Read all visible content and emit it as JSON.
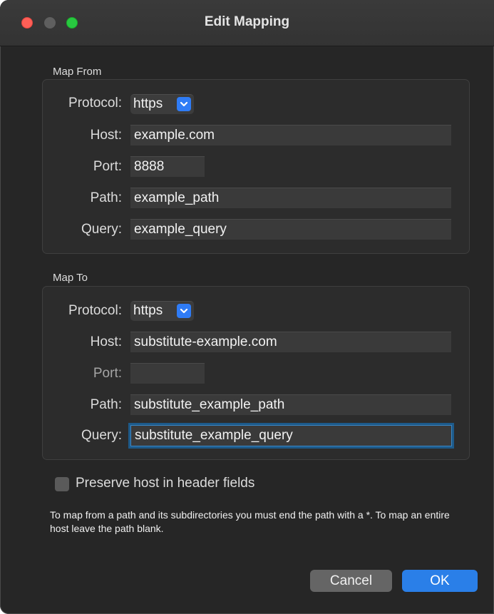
{
  "window": {
    "title": "Edit Mapping"
  },
  "map_from": {
    "section_label": "Map From",
    "protocol_label": "Protocol:",
    "protocol_value": "https",
    "host_label": "Host:",
    "host_value": "example.com",
    "port_label": "Port:",
    "port_value": "8888",
    "path_label": "Path:",
    "path_value": "example_path",
    "query_label": "Query:",
    "query_value": "example_query"
  },
  "map_to": {
    "section_label": "Map To",
    "protocol_label": "Protocol:",
    "protocol_value": "https",
    "host_label": "Host:",
    "host_value": "substitute-example.com",
    "port_label": "Port:",
    "port_value": "",
    "path_label": "Path:",
    "path_value": "substitute_example_path",
    "query_label": "Query:",
    "query_value": "substitute_example_query"
  },
  "options": {
    "preserve_host_label": "Preserve host in header fields",
    "preserve_host_checked": false
  },
  "hint_text": "To map from a path and its subdirectories you must end the path with a *. To map an entire host leave the path blank.",
  "buttons": {
    "cancel": "Cancel",
    "ok": "OK"
  },
  "colors": {
    "accent": "#2a7fe8",
    "window_bg": "#262626",
    "focus_ring": "#1d5a8a"
  },
  "icons": {
    "dropdown": "chevron-down-icon",
    "close": "close-window-icon",
    "minimize": "minimize-window-icon",
    "zoom": "zoom-window-icon"
  }
}
